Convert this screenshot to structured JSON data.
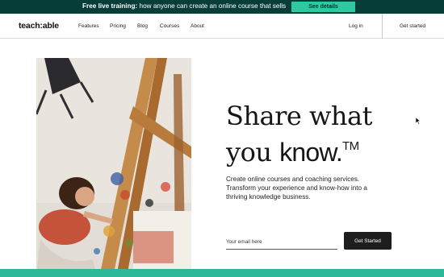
{
  "banner": {
    "bold_text": "Free live training:",
    "text": " how anyone can create an online course that sells",
    "cta": "See details"
  },
  "nav": {
    "logo": "teach:able",
    "links": [
      "Features",
      "Pricing",
      "Blog",
      "Courses",
      "About"
    ],
    "login": "Log in",
    "get_started": "Get started"
  },
  "hero": {
    "headline_line1": "Share what",
    "headline_line2_prefix": "you ",
    "headline_line2_bold": "know.",
    "trademark": "TM",
    "subtext": "Create online courses and coaching services. Transform your experience and know-how into a thriving knowledge business.",
    "email_placeholder": "Your email here",
    "cta": "Get Started"
  },
  "colors": {
    "banner_bg": "#073d39",
    "banner_cta": "#2dc9a1",
    "footer_strip": "#2db89a"
  }
}
